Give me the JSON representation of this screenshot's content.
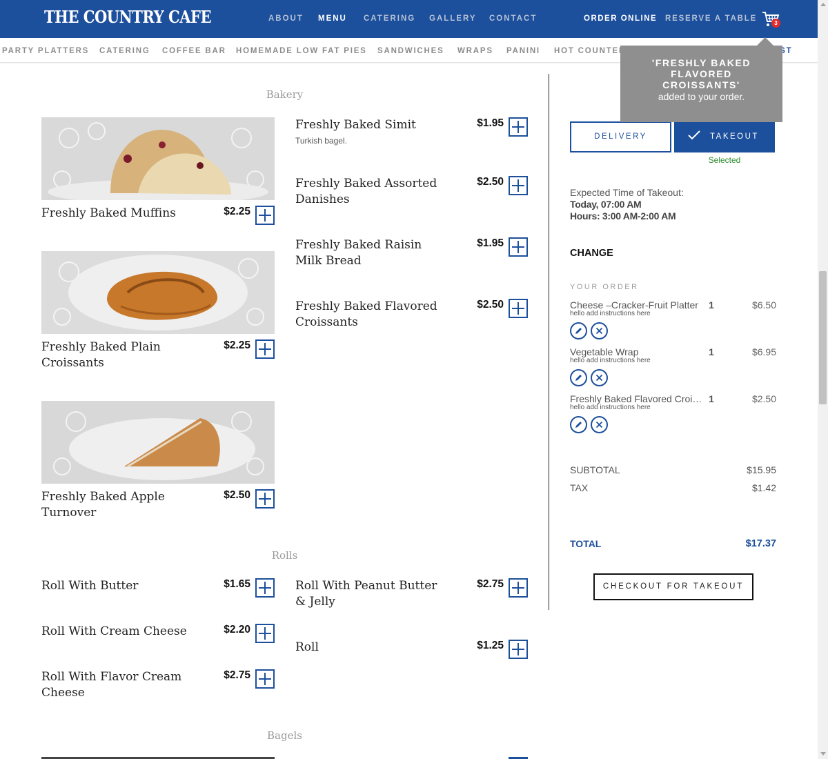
{
  "header": {
    "logo": "THE COUNTRY CAFE",
    "nav": [
      "ABOUT",
      "MENU",
      "CATERING",
      "GALLERY",
      "CONTACT"
    ],
    "active_nav": "MENU",
    "order_online": "ORDER ONLINE",
    "reserve": "RESERVE A TABLE",
    "cart_count": "3",
    "brand_color": "#1c4f9c"
  },
  "subnav": [
    "PARTY PLATTERS",
    "CATERING",
    "COFFEE BAR",
    "HOMEMADE LOW FAT PIES",
    "SANDWICHES",
    "WRAPS",
    "PANINI",
    "HOT COUNTER",
    "AST"
  ],
  "toast": {
    "title": "'FRESHLY BAKED FLAVORED CROISSANTS'",
    "sub": "added to your order."
  },
  "bakery": {
    "title": "Bakery",
    "left": [
      {
        "name": "Freshly Baked Muffins",
        "price": "$2.25"
      },
      {
        "name": "Freshly Baked Plain Croissants",
        "price": "$2.25"
      },
      {
        "name": "Freshly Baked Apple Turnover",
        "price": "$2.50"
      }
    ],
    "right": [
      {
        "name": "Freshly Baked Simit",
        "desc": "Turkish bagel.",
        "price": "$1.95"
      },
      {
        "name": "Freshly Baked Assorted Danishes",
        "price": "$2.50"
      },
      {
        "name": "Freshly Baked Raisin Milk Bread",
        "price": "$1.95"
      },
      {
        "name": "Freshly Baked Flavored Croissants",
        "price": "$2.50"
      }
    ]
  },
  "rolls": {
    "title": "Rolls",
    "left": [
      {
        "name": "Roll With Butter",
        "price": "$1.65"
      },
      {
        "name": "Roll With Cream Cheese",
        "price": "$2.20"
      },
      {
        "name": "Roll With Flavor Cream Cheese",
        "price": "$2.75"
      }
    ],
    "right": [
      {
        "name": "Roll With Peanut Butter & Jelly",
        "price": "$2.75"
      },
      {
        "name": "Roll",
        "price": "$1.25"
      }
    ]
  },
  "bagels": {
    "title": "Bagels"
  },
  "sidebar": {
    "delivery": "DELIVERY",
    "takeout": "TAKEOUT",
    "selected": "Selected",
    "expected_label": "Expected Time of Takeout:",
    "expected_time": "Today, 07:00 AM",
    "hours": "Hours: 3:00 AM-2:00 AM",
    "change": "CHANGE",
    "your_order": "YOUR ORDER",
    "items": [
      {
        "name": "Cheese –Cracker-Fruit Platter",
        "qty": "1",
        "price": "$6.50",
        "note": "hello add instructions here"
      },
      {
        "name": "Vegetable Wrap",
        "qty": "1",
        "price": "$6.95",
        "note": "hello add instructions here"
      },
      {
        "name": "Freshly Baked Flavored Croissants",
        "qty": "1",
        "price": "$2.50",
        "note": "hello add instructions here"
      }
    ],
    "subtotal_label": "SUBTOTAL",
    "subtotal": "$15.95",
    "tax_label": "TAX",
    "tax": "$1.42",
    "total_label": "TOTAL",
    "total": "$17.37",
    "checkout": "CHECKOUT FOR TAKEOUT",
    "selected_color": "#2a8a2a"
  }
}
